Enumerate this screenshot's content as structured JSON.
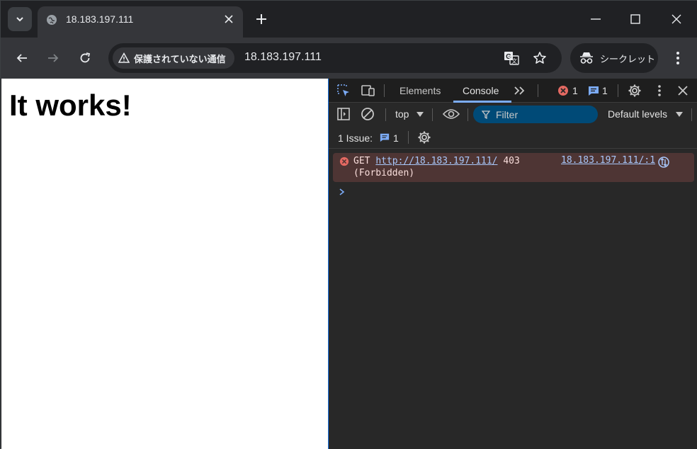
{
  "browser": {
    "tab_title": "18.183.197.111",
    "security_label": "保護されていない通信",
    "url": "18.183.197.111",
    "incognito_label": "シークレット"
  },
  "page": {
    "heading": "It works!"
  },
  "devtools": {
    "tabs": [
      "Elements",
      "Console"
    ],
    "error_count": "1",
    "message_count": "1",
    "context": "top",
    "filter_placeholder": "Filter",
    "levels": "Default levels",
    "issues_label": "1 Issue:",
    "issues_count": "1",
    "console": {
      "method": "GET",
      "url": "http://18.183.197.111/",
      "status": "403",
      "status_text": "(Forbidden)",
      "source": "18.183.197.111/:1"
    }
  },
  "colors": {
    "accent": "#7cacf8",
    "error_bg": "#4e3534",
    "error_icon": "#e46962"
  }
}
